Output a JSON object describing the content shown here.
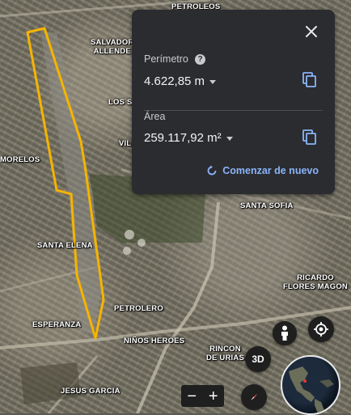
{
  "places": [
    {
      "name": "PETROLEOS"
    },
    {
      "name": "SALVADOR\nALLENDE"
    },
    {
      "name": "LOS SA"
    },
    {
      "name": "VILL"
    },
    {
      "name": "MORELOS"
    },
    {
      "name": "SANTA ELENA"
    },
    {
      "name": "SANTA SOFIA"
    },
    {
      "name": "RICARDO\nFLORES MAGON"
    },
    {
      "name": "PETROLERO"
    },
    {
      "name": "ESPERANZA"
    },
    {
      "name": "NIÑOS HEROES"
    },
    {
      "name": "RINCON\nDE URIAS"
    },
    {
      "name": "JESUS GARCIA"
    }
  ],
  "panel": {
    "perimeter_label": "Perímetro",
    "perimeter_value": "4.622,85 m",
    "area_label": "Área",
    "area_value": "259.117,92 m²",
    "restart_label": "Comenzar de nuevo"
  },
  "controls": {
    "view_3d_label": "3D",
    "zoom_out_label": "−",
    "zoom_in_label": "+"
  },
  "colors": {
    "measure_outline": "#f5b400",
    "accent": "#8ab4f8",
    "panel_bg": "#2b2c30"
  },
  "icons": [
    "close-icon",
    "help-icon",
    "copy-icon",
    "restart-icon",
    "pegman-icon",
    "locate-icon",
    "compass-icon",
    "globe-icon"
  ]
}
